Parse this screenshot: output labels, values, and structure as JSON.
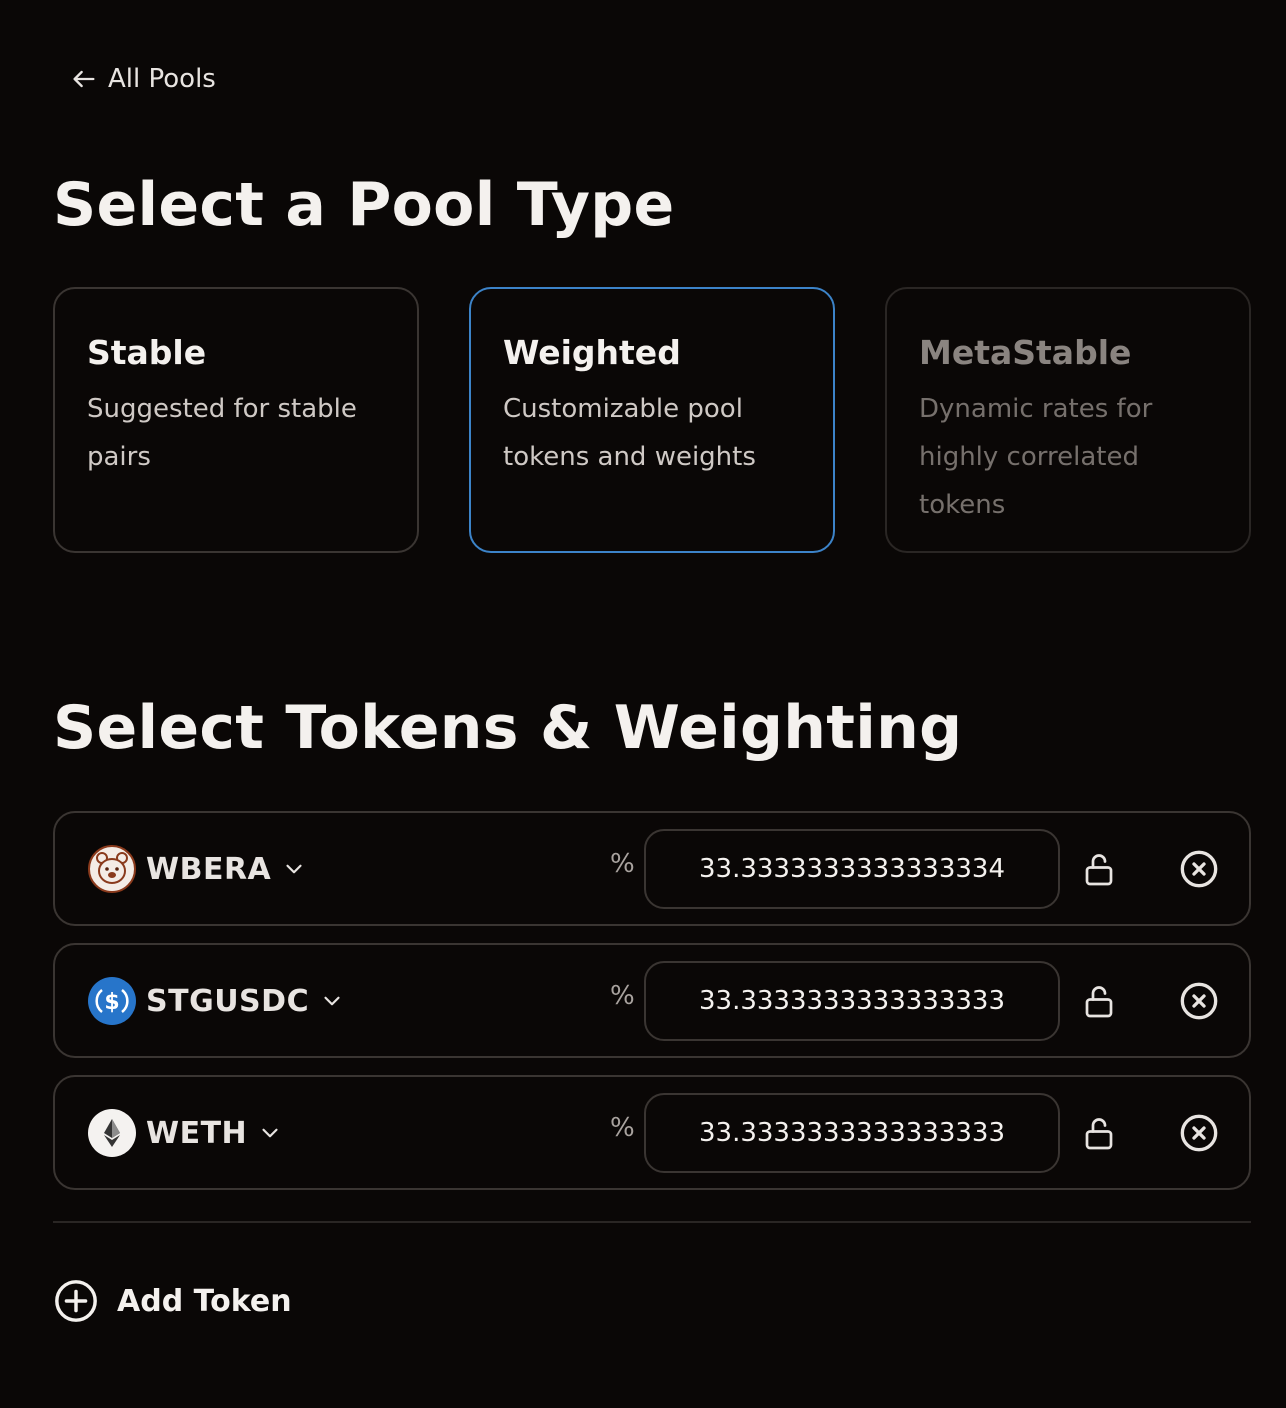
{
  "nav": {
    "back_label": "All Pools",
    "back_icon": "arrow-left-icon"
  },
  "pool_section": {
    "title": "Select a Pool Type",
    "options": [
      {
        "title": "Stable",
        "description": "Suggested for stable pairs",
        "state": "default"
      },
      {
        "title": "Weighted",
        "description": "Customizable pool tokens and weights",
        "state": "selected"
      },
      {
        "title": "MetaStable",
        "description": "Dynamic rates for highly correlated tokens",
        "state": "disabled"
      }
    ]
  },
  "token_section": {
    "title": "Select Tokens & Weighting",
    "percent_symbol": "%",
    "tokens": [
      {
        "symbol": "WBERA",
        "icon": "bera-token-icon",
        "weight": "33.3333333333333334",
        "lock_icon": "unlock-icon",
        "remove_icon": "close-circle-icon"
      },
      {
        "symbol": "STGUSDC",
        "icon": "usdc-token-icon",
        "weight": "33.3333333333333333",
        "lock_icon": "unlock-icon",
        "remove_icon": "close-circle-icon"
      },
      {
        "symbol": "WETH",
        "icon": "eth-token-icon",
        "weight": "33.3333333333333333",
        "lock_icon": "unlock-icon",
        "remove_icon": "close-circle-icon"
      }
    ],
    "add_token_label": "Add Token",
    "add_token_icon": "plus-circle-icon"
  },
  "colors": {
    "background": "#0a0706",
    "selected_border": "#3c83c8",
    "border": "#3a3532"
  }
}
